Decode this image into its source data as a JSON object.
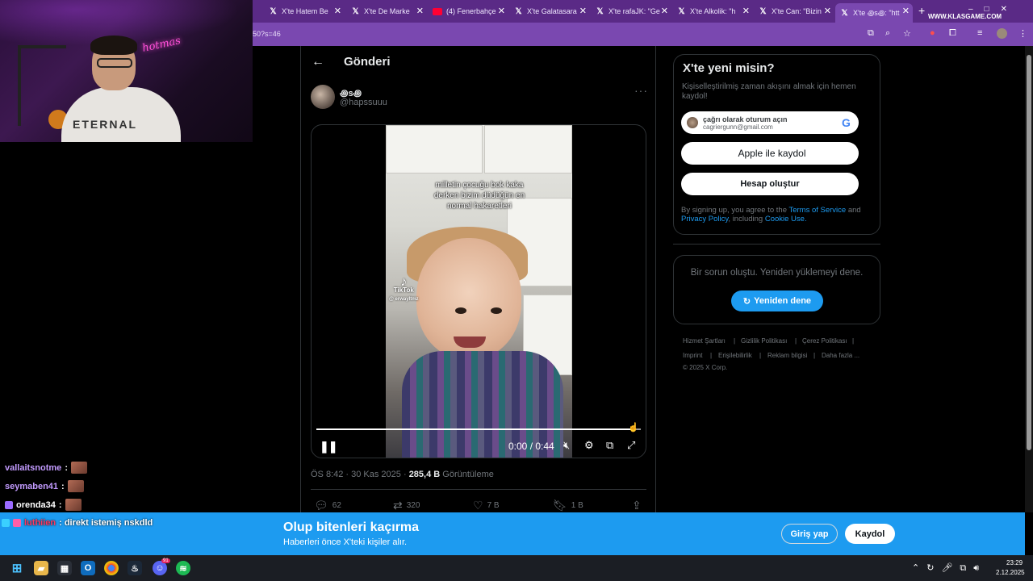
{
  "browser": {
    "tabs": [
      {
        "label": "X'te Hatem Be",
        "icon": "x-logo"
      },
      {
        "label": "X'te De Marke",
        "icon": "x-logo"
      },
      {
        "label": "(4) Fenerbahçe",
        "icon": "youtube-logo"
      },
      {
        "label": "X'te Galatasara",
        "icon": "x-logo"
      },
      {
        "label": "X'te rafaJK: \"Ge",
        "icon": "x-logo"
      },
      {
        "label": "X'te Alkolik: \"h",
        "icon": "x-logo"
      },
      {
        "label": "X'te Can: \"Bizin",
        "icon": "x-logo"
      },
      {
        "label": "X'te ꩜s꩜: \"htt",
        "icon": "x-logo",
        "active": true
      }
    ],
    "url_fragment": "50?s=46",
    "stream_watermark": "WWW.KLASGAME.COM"
  },
  "post": {
    "header_title": "Gönderi",
    "author_name": "꩜s꩜",
    "author_handle": "@hapssuuu",
    "video": {
      "caption": "milletin çocuğu bok kaka derken bizim düdüğün en normal hakaretleri",
      "watermark_app": "TikTok",
      "watermark_user": "@ erwayltmz",
      "time": "0:00 / 0:44",
      "progress": 0.97
    },
    "meta_time": "ÖS 8:42 · 30 Kas 2025 · ",
    "views_count": "285,4 B",
    "views_label": " Görüntüleme",
    "stats": {
      "replies": "62",
      "reposts": "320",
      "likes": "7 B",
      "bookmarks": "1 B"
    }
  },
  "sidebar": {
    "signup_title": "X'te yeni misin?",
    "signup_desc": "Kişiselleştirilmiş zaman akışını almak için hemen kaydol!",
    "google_name": "çağrı olarak oturum açın",
    "google_email": "cagriergunn@gmail.com",
    "apple_label": "Apple ile kaydol",
    "create_label": "Hesap oluştur",
    "terms_prefix": "By signing up, you agree to the ",
    "terms_link": "Terms of Service",
    "terms_and": " and ",
    "privacy_link": "Privacy Policy",
    "terms_including": ", including ",
    "cookie_link": "Cookie Use.",
    "error_text": "Bir sorun oluştu. Yeniden yüklemeyi dene.",
    "retry_label": "Yeniden dene",
    "footer": {
      "terms": "Hizmet Şartları",
      "privacy": "Gizlilik Politikası",
      "cookie": "Çerez Politikası",
      "imprint": "Imprint",
      "accessibility": "Erişilebilirlik",
      "ads": "Reklam bilgisi",
      "more": "Daha fazla ...",
      "copyright": "© 2025 X Corp."
    }
  },
  "chat": [
    {
      "user": "vallaitsnotme",
      "message": ":"
    },
    {
      "user": "seymaben41",
      "message": ":"
    },
    {
      "user": "orenda34",
      "message": ":"
    }
  ],
  "chat_overlay": {
    "user": "luthiien",
    "message": ": direkt istemiş nskdld"
  },
  "banner": {
    "title": "Olup bitenleri kaçırma",
    "subtitle": "Haberleri önce X'teki kişiler alır.",
    "login": "Giriş yap",
    "register": "Kaydol"
  },
  "taskbar": {
    "time": "23:29",
    "date": "2.12.2025",
    "discord_badge": "91"
  },
  "colors": {
    "accent": "#1d9bf0",
    "browser_frame": "#7a48b0",
    "background": "#000000"
  }
}
